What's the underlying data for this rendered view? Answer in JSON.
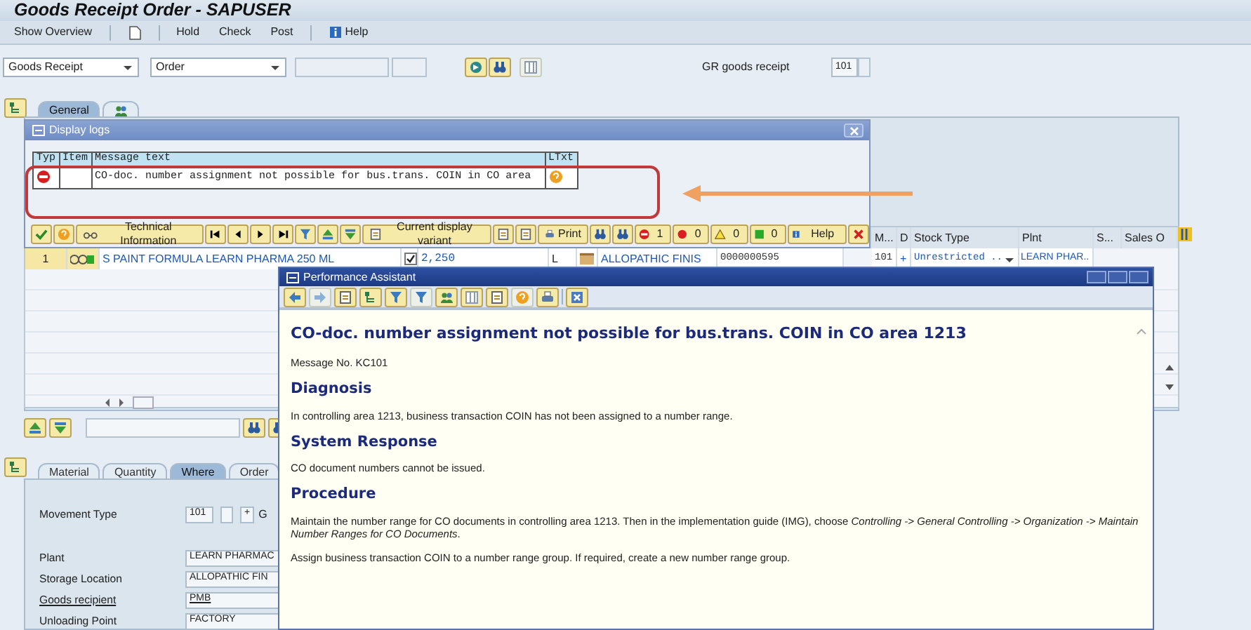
{
  "window": {
    "title": "Goods Receipt Order - SAPUSER"
  },
  "toolbar": [
    {
      "kind": "text",
      "label": "Show Overview"
    },
    {
      "kind": "new"
    },
    {
      "kind": "text",
      "label": "Hold"
    },
    {
      "kind": "text",
      "label": "Check"
    },
    {
      "kind": "text",
      "label": "Post"
    },
    {
      "kind": "info",
      "label": "Help"
    }
  ],
  "selection": {
    "transaction": "Goods Receipt",
    "reference": "Order",
    "gr_label": "GR goods receipt",
    "movement_type": "101"
  },
  "header_tabs": [
    {
      "kind": "text",
      "label": "General",
      "selected": true
    },
    {
      "kind": "people",
      "selected": false
    }
  ],
  "item_grid": {
    "columns": [
      "M...",
      "D",
      "Stock Type",
      "Plnt",
      "S...",
      "Sales O"
    ],
    "rows": [
      {
        "line": "1",
        "material": "S PAINT FORMULA LEARN PHARMA 250 ML",
        "ok": true,
        "quantity": "2,250",
        "unit": "L",
        "storage_location": "ALLOPATHIC FINIS",
        "batch": "0000000595",
        "movement_type": "101",
        "debit_credit": "+",
        "stock_type": "Unrestricted ..",
        "plant": "LEARN PHAR.."
      }
    ]
  },
  "log_dialog": {
    "title": "Display logs",
    "columns": [
      "Typ",
      "Item",
      "Message text",
      "LTxt"
    ],
    "rows": [
      {
        "text": "CO-doc. number assignment not possible for bus.trans. COIN in CO area"
      }
    ],
    "toolbar": {
      "buttons": [
        "Technical Information",
        "Current display variant",
        "Print",
        "Help"
      ],
      "counters": [
        {
          "kind": "stop",
          "count": "1"
        },
        {
          "kind": "error",
          "count": "0"
        },
        {
          "kind": "warning",
          "count": "0"
        },
        {
          "kind": "success",
          "count": "0"
        }
      ]
    }
  },
  "item_tabs": [
    {
      "label": "Material",
      "selected": false
    },
    {
      "label": "Quantity",
      "selected": false
    },
    {
      "label": "Where",
      "selected": true
    },
    {
      "label": "Order",
      "selected": false
    }
  ],
  "item_fields": [
    {
      "kind": "movement",
      "label": "Movement Type",
      "value": "101",
      "debit_credit": "+",
      "trailing": "G",
      "link": false
    },
    {
      "kind": "field",
      "label": "Plant",
      "value": "LEARN PHARMAC",
      "link": false
    },
    {
      "kind": "field",
      "label": "Storage Location",
      "value": "ALLOPATHIC FIN",
      "link": false
    },
    {
      "kind": "field",
      "label": "Goods recipient",
      "value": "PMB",
      "link": true
    },
    {
      "kind": "field",
      "label": "Unloading Point",
      "value": "FACTORY",
      "link": false
    }
  ],
  "assistant": {
    "title": "Performance Assistant",
    "heading": "CO-doc. number assignment not possible for bus.trans. COIN in CO area 1213",
    "message_no": "Message No. KC101",
    "sections": [
      {
        "heading": "Diagnosis",
        "paragraphs": [
          "In controlling area 1213, business transaction COIN has not been assigned to a number range."
        ]
      },
      {
        "heading": "System Response",
        "paragraphs": [
          "CO document numbers cannot be issued."
        ]
      },
      {
        "heading": "Procedure",
        "paragraphs": [
          "Maintain the number range for CO documents in controlling area 1213. Then in the implementation guide (IMG), choose *Controlling -> General Controlling -> Organization -> Maintain Number Ranges for CO Documents*.",
          "Assign business transaction COIN to a number range group. If required, create a new number range group."
        ]
      }
    ]
  }
}
